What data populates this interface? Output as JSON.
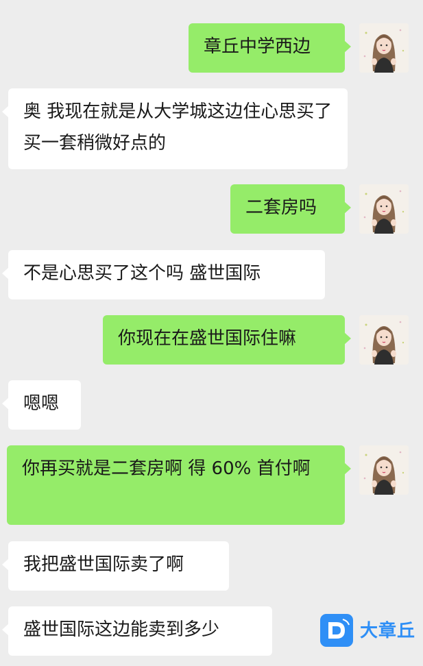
{
  "messages": [
    {
      "side": "sent",
      "text": "章丘中学西边"
    },
    {
      "side": "recv",
      "text": "奥  我现在就是从大学城这边住心思买了  买一套稍微好点的"
    },
    {
      "side": "sent",
      "text": "二套房吗"
    },
    {
      "side": "recv",
      "text": "不是心思买了这个吗  盛世国际"
    },
    {
      "side": "sent",
      "text": "你现在在盛世国际住嘛"
    },
    {
      "side": "recv",
      "text": "嗯嗯"
    },
    {
      "side": "sent",
      "text": "你再买就是二套房啊  得 60% 首付啊"
    },
    {
      "side": "recv",
      "text": "我把盛世国际卖了啊"
    },
    {
      "side": "recv",
      "text": "盛世国际这边能卖到多少"
    }
  ],
  "watermark": {
    "text": "大章丘"
  },
  "colors": {
    "sent": "#95ec69",
    "recv": "#ffffff",
    "background": "#ededed",
    "brand": "#2f8ff6"
  },
  "icons": {
    "avatar": "avatar-girl-illustration",
    "logo": "d-logo-icon"
  }
}
